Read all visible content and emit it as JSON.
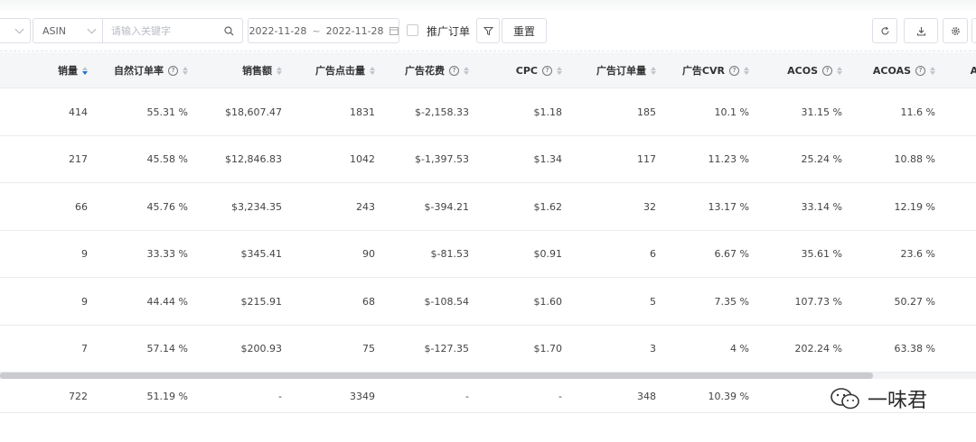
{
  "toolbar": {
    "asin_select": "ASIN",
    "search_placeholder": "请输入关键字",
    "date_start": "2022-11-28",
    "date_sep": "~",
    "date_end": "2022-11-28",
    "promo_order_label": "推广订单",
    "reset_label": "重置"
  },
  "table": {
    "columns": [
      {
        "label": "销量",
        "help": false,
        "sort": "desc"
      },
      {
        "label": "自然订单率",
        "help": true,
        "sort": "none"
      },
      {
        "label": "销售额",
        "help": false,
        "sort": "none"
      },
      {
        "label": "广告点击量",
        "help": false,
        "sort": "none"
      },
      {
        "label": "广告花费",
        "help": true,
        "sort": "none"
      },
      {
        "label": "CPC",
        "help": true,
        "sort": "none"
      },
      {
        "label": "广告订单量",
        "help": false,
        "sort": "none"
      },
      {
        "label": "广告CVR",
        "help": true,
        "sort": "none"
      },
      {
        "label": "ACOS",
        "help": true,
        "sort": "none"
      },
      {
        "label": "ACOAS",
        "help": true,
        "sort": "none"
      },
      {
        "label": "AS",
        "help": false,
        "sort": "none"
      }
    ],
    "rows": [
      [
        "414",
        "55.31 %",
        "$18,607.47",
        "1831",
        "$-2,158.33",
        "$1.18",
        "185",
        "10.1 %",
        "31.15 %",
        "11.6 %"
      ],
      [
        "217",
        "45.58 %",
        "$12,846.83",
        "1042",
        "$-1,397.53",
        "$1.34",
        "117",
        "11.23 %",
        "25.24 %",
        "10.88 %"
      ],
      [
        "66",
        "45.76 %",
        "$3,234.35",
        "243",
        "$-394.21",
        "$1.62",
        "32",
        "13.17 %",
        "33.14 %",
        "12.19 %"
      ],
      [
        "9",
        "33.33 %",
        "$345.41",
        "90",
        "$-81.53",
        "$0.91",
        "6",
        "6.67 %",
        "35.61 %",
        "23.6 %"
      ],
      [
        "9",
        "44.44 %",
        "$215.91",
        "68",
        "$-108.54",
        "$1.60",
        "5",
        "7.35 %",
        "107.73 %",
        "50.27 %"
      ],
      [
        "7",
        "57.14 %",
        "$200.93",
        "75",
        "$-127.35",
        "$1.70",
        "3",
        "4 %",
        "202.24 %",
        "63.38 %"
      ]
    ],
    "totals": [
      "722",
      "51.19 %",
      "-",
      "3349",
      "-",
      "-",
      "348",
      "10.39 %"
    ]
  },
  "watermark": {
    "text": "一味君",
    "icon": "wechat-icon"
  },
  "colors": {
    "sort_active": "#1f6fd1",
    "header_bg": "#f5f6f8"
  }
}
